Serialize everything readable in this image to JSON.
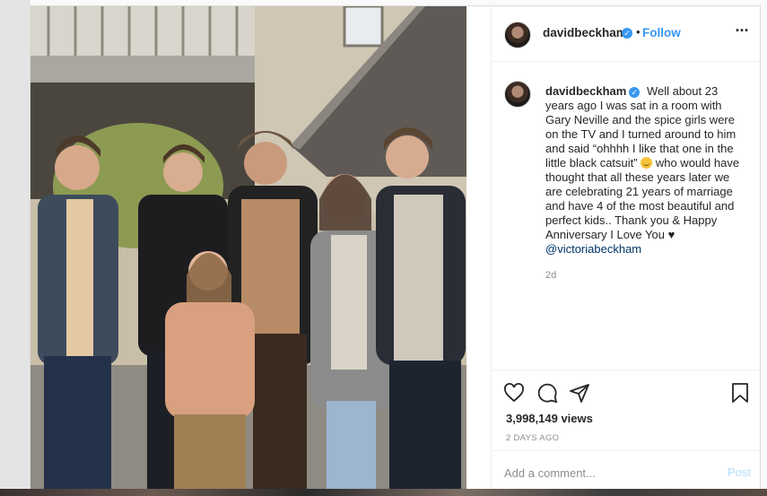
{
  "post": {
    "username": "davidbeckham",
    "verified": true,
    "follow_label": "Follow",
    "separator": "•",
    "more_icon": "more-horizontal-icon",
    "caption_text": "Well about 23 years ago I was sat in a room with Gary Neville and the spice girls were on the TV and I turned around to him and said “ohhhh I like that one in the little black catsuit”",
    "caption_emoji": "grinning-face-emoji",
    "caption_text_2": "who would have thought that all these years later we are celebrating 21 years of marriage and have 4 of the most beautiful and perfect kids.. Thank you & Happy Anniversary I Love You ♥",
    "mention": "@victoriabeckham",
    "age": "2d",
    "views": "3,998,149 views",
    "posted_date": "2 DAYS AGO",
    "comment_placeholder": "Add a comment...",
    "post_label": "Post"
  },
  "icons": {
    "like": "heart-icon",
    "comment": "comment-icon",
    "share": "share-icon",
    "save": "bookmark-icon"
  },
  "colors": {
    "link_blue": "#3897f0",
    "post_disabled": "#b2dffc",
    "mention": "#003569",
    "muted": "#8e8e8e"
  }
}
